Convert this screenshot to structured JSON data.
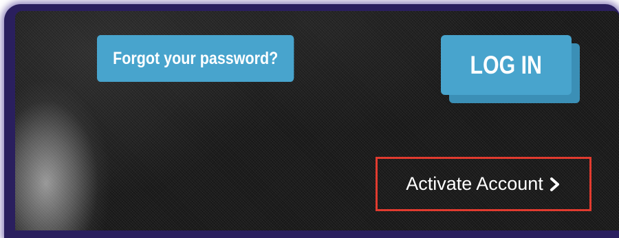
{
  "login_panel": {
    "forgot_password_label": "Forgot your password?",
    "login_label": "LOG IN",
    "activate_account_label": "Activate Account",
    "chevron_icon": "chevron-right-icon",
    "colors": {
      "button_bg": "#48a4cd",
      "button_shadow": "#3b8fb6",
      "panel_bg": "#1c1c1c",
      "highlight_border": "#e13b2f",
      "frame_glow": "#2a1f5e"
    }
  }
}
